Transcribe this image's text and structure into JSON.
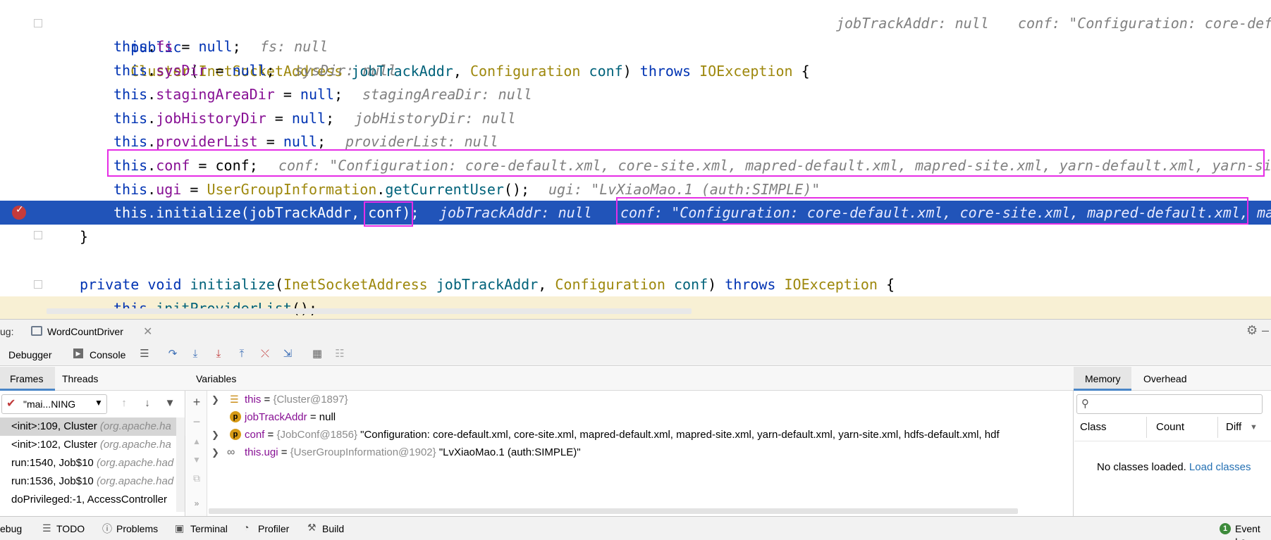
{
  "editor": {
    "lines": {
      "l1": {
        "kw_public": "public",
        "ctor": "Cluster",
        "p1": "(",
        "t1": "InetSocketAddress",
        "v1": " jobTrackAddr",
        "c1": ", ",
        "t2": "Configuration",
        "v2": " conf",
        "p2": ") ",
        "kw_throws": "throws",
        "sp": " ",
        "t3": "IOException",
        "br": " {",
        "hint1": "jobTrackAddr: null",
        "hint2": "conf: \"Configuration: core-def"
      },
      "l2": {
        "this": "this",
        "dot": ".",
        "field": "fs",
        "rest": " = ",
        "null": "null",
        "semi": ";",
        "hint": "fs: null"
      },
      "l3": {
        "this": "this",
        "dot": ".",
        "field": "sysDir",
        "rest": " = ",
        "null": "null",
        "semi": ";",
        "hint": "sysDir: null"
      },
      "l4": {
        "this": "this",
        "dot": ".",
        "field": "stagingAreaDir",
        "rest": " = ",
        "null": "null",
        "semi": ";",
        "hint": "stagingAreaDir: null"
      },
      "l5": {
        "this": "this",
        "dot": ".",
        "field": "jobHistoryDir",
        "rest": " = ",
        "null": "null",
        "semi": ";",
        "hint": "jobHistoryDir: null"
      },
      "l6": {
        "this": "this",
        "dot": ".",
        "field": "providerList",
        "rest": " = ",
        "null": "null",
        "semi": ";",
        "hint": "providerList: null"
      },
      "l7": {
        "this": "this",
        "dot": ".",
        "field": "conf",
        "rest": " = ",
        "val": "conf",
        "semi": ";",
        "hint": "conf: \"Configuration: core-default.xml, core-site.xml, mapred-default.xml, mapred-site.xml, yarn-default.xml, yarn-si"
      },
      "l8": {
        "this": "this",
        "dot": ".",
        "field": "ugi",
        "rest": " = ",
        "cls": "UserGroupInformation",
        "dot2": ".",
        "method": "getCurrentUser",
        "end": "();",
        "hint": "ugi: \"LvXiaoMao.1 (auth:SIMPLE)\""
      },
      "l9": {
        "code": "this.initialize(jobTrackAddr, ",
        "arg": "conf)",
        "semi": ";",
        "hint1": "jobTrackAddr: null",
        "hint2": "conf: \"Configuration: core-default.xml, core-site.xml, mapred-default.xml, ma"
      },
      "l10": {
        "text": "}"
      },
      "l12": {
        "kw_private": "private",
        "kw_void": " void ",
        "method": "initialize",
        "p1": "(",
        "t1": "InetSocketAddress",
        "v1": " jobTrackAddr",
        "c1": ", ",
        "t2": "Configuration",
        "v2": " conf",
        "p2": ") ",
        "kw_throws": "throws",
        "sp": " ",
        "t3": "IOException",
        "br": " {"
      },
      "l13": {
        "this": "this",
        "dot": ".",
        "method": "initProviderList",
        "end": "();"
      }
    }
  },
  "debug": {
    "title_prefix": "ug:",
    "run_tab": "WordCountDriver",
    "toolbar": {
      "debugger": "Debugger",
      "console": "Console"
    },
    "frames_tab": "Frames",
    "threads_tab": "Threads",
    "variables_header": "Variables",
    "thread_select": "\"mai...NING",
    "frames": [
      {
        "method": "<init>:109, Cluster ",
        "pkg": "(org.apache.ha"
      },
      {
        "method": "<init>:102, Cluster ",
        "pkg": "(org.apache.ha"
      },
      {
        "method": "run:1540, Job$10 ",
        "pkg": "(org.apache.had"
      },
      {
        "method": "run:1536, Job$10 ",
        "pkg": "(org.apache.had"
      },
      {
        "method": "doPrivileged:-1, AccessController",
        "pkg": ""
      }
    ],
    "variables": [
      {
        "name": "this",
        "eq": " = ",
        "ref": "{Cluster@1897}",
        "val": ""
      },
      {
        "name": "jobTrackAddr",
        "eq": " = ",
        "ref": "",
        "val": "null"
      },
      {
        "name": "conf",
        "eq": " = ",
        "ref": "{JobConf@1856}",
        "val": " \"Configuration: core-default.xml, core-site.xml, mapred-default.xml, mapred-site.xml, yarn-default.xml, yarn-site.xml, hdfs-default.xml, hdf"
      },
      {
        "name": "this.ugi",
        "eq": " = ",
        "ref": "{UserGroupInformation@1902}",
        "val": " \"LvXiaoMao.1 (auth:SIMPLE)\""
      }
    ],
    "memory": {
      "tab_memory": "Memory",
      "tab_overhead": "Overhead",
      "col_class": "Class",
      "col_count": "Count",
      "col_diff": "Diff",
      "empty_text": "No classes loaded.",
      "load_link": "Load classes"
    }
  },
  "statusbar": {
    "debug": "ebug",
    "todo": "TODO",
    "problems": "Problems",
    "terminal": "Terminal",
    "profiler": "Profiler",
    "build": "Build",
    "event_log": "Event Lo"
  }
}
